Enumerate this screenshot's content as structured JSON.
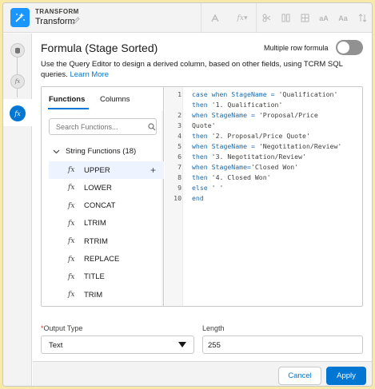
{
  "header": {
    "eyebrow": "TRANSFORM",
    "title": "Transform",
    "toolbar": [
      {
        "name": "toolbar-branch-icon",
        "label": ""
      },
      {
        "name": "toolbar-formula-icon",
        "label": "fx"
      },
      {
        "name": "toolbar-split-icon",
        "label": ""
      },
      {
        "name": "toolbar-columns-icon",
        "label": ""
      },
      {
        "name": "toolbar-table-icon",
        "label": ""
      },
      {
        "name": "toolbar-uppercase-icon",
        "label": "aA"
      },
      {
        "name": "toolbar-case-icon",
        "label": "Aa"
      },
      {
        "name": "toolbar-sort-icon",
        "label": ""
      }
    ]
  },
  "rail": {
    "nodes": [
      {
        "name": "rail-node-data-icon"
      },
      {
        "name": "rail-node-formula-icon",
        "label": "fx"
      }
    ],
    "active_label": "fx"
  },
  "panel": {
    "title": "Formula (Stage Sorted)",
    "multiple_row_label": "Multiple row formula",
    "multiple_row_enabled": false,
    "description": "Use the Query Editor to design a derived column, based on other fields, using TCRM SQL queries.",
    "learn_more": "Learn More"
  },
  "functions": {
    "tabs": [
      "Functions",
      "Columns"
    ],
    "active_tab": "Functions",
    "search_placeholder": "Search Functions...",
    "group_label": "String Functions (18)",
    "items": [
      "UPPER",
      "LOWER",
      "CONCAT",
      "LTRIM",
      "RTRIM",
      "REPLACE",
      "TITLE",
      "TRIM"
    ],
    "selected": "UPPER",
    "fx_glyph": "fx"
  },
  "editor": {
    "lines": [
      {
        "n": "1",
        "parts": [
          [
            "kw",
            "case when "
          ],
          [
            "plain",
            "StageName"
          ],
          [
            "kw",
            " = "
          ],
          [
            "str",
            "'Qualification'"
          ]
        ]
      },
      {
        "n": "",
        "parts": [
          [
            "kw",
            "then "
          ],
          [
            "str",
            "'1. Qualification'"
          ]
        ]
      },
      {
        "n": "2",
        "parts": [
          [
            "kw",
            "when "
          ],
          [
            "plain",
            "StageName"
          ],
          [
            "kw",
            " = "
          ],
          [
            "str",
            "'Proposal/Price"
          ]
        ]
      },
      {
        "n": "3",
        "parts": [
          [
            "str",
            "Quote'"
          ]
        ]
      },
      {
        "n": "4",
        "parts": [
          [
            "kw",
            "then "
          ],
          [
            "str",
            "'2. Proposal/Price Quote'"
          ]
        ]
      },
      {
        "n": "5",
        "parts": [
          [
            "kw",
            "when "
          ],
          [
            "plain",
            "StageName"
          ],
          [
            "kw",
            " = "
          ],
          [
            "str",
            "'Negotitation/Review'"
          ]
        ]
      },
      {
        "n": "6",
        "parts": [
          [
            "kw",
            "then "
          ],
          [
            "str",
            "'3. Negotitation/Review'"
          ]
        ]
      },
      {
        "n": "7",
        "parts": [
          [
            "kw",
            "when "
          ],
          [
            "plain",
            "StageName"
          ],
          [
            "kw",
            "="
          ],
          [
            "str",
            "'Closed Won'"
          ]
        ]
      },
      {
        "n": "8",
        "parts": [
          [
            "kw",
            "then "
          ],
          [
            "str",
            "'4. Closed Won'"
          ]
        ]
      },
      {
        "n": "9",
        "parts": [
          [
            "kw",
            "else "
          ],
          [
            "str",
            "' '"
          ]
        ]
      },
      {
        "n": "10",
        "parts": [
          [
            "kw",
            "end"
          ]
        ]
      }
    ]
  },
  "form": {
    "output_type_label": "Output Type",
    "output_type_value": "Text",
    "length_label": "Length",
    "length_value": "255"
  },
  "footer": {
    "cancel": "Cancel",
    "apply": "Apply"
  },
  "colors": {
    "brand": "#0176d3",
    "app_icon": "#1b96ff",
    "required": "#c23934",
    "page_border": "#f7e9a8"
  }
}
